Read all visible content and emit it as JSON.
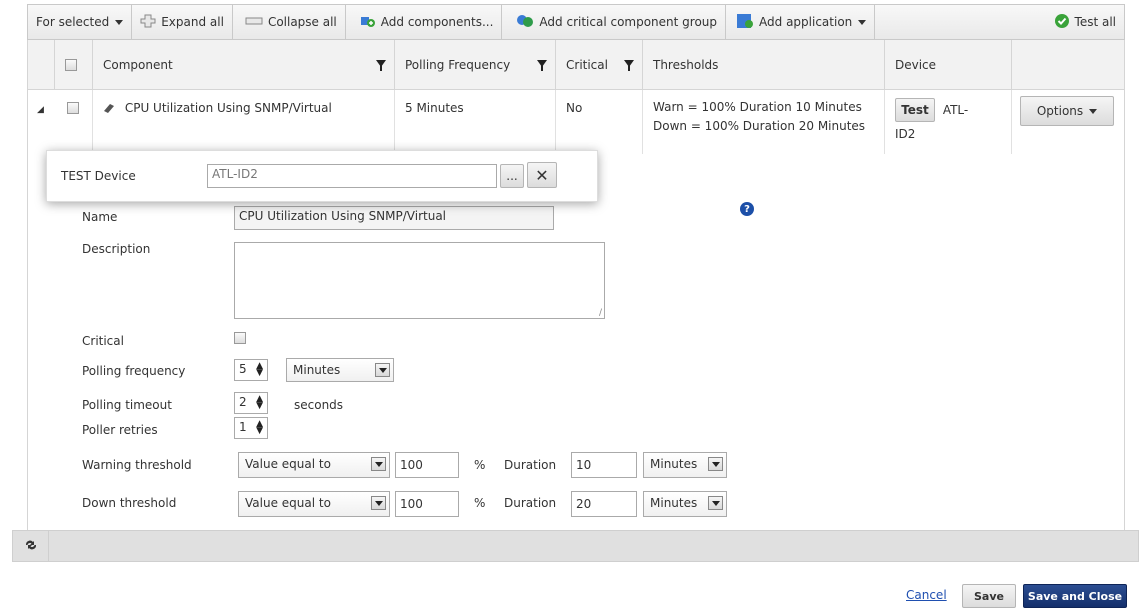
{
  "toolbar": {
    "for_selected": "For selected",
    "expand_all": "Expand all",
    "collapse_all": "Collapse all",
    "add_components": "Add components...",
    "add_critical_group": "Add critical component group",
    "add_application": "Add application",
    "test_all": "Test all"
  },
  "columns": {
    "component": "Component",
    "polling_frequency": "Polling Frequency",
    "critical": "Critical",
    "thresholds": "Thresholds",
    "device": "Device"
  },
  "row": {
    "component": "CPU Utilization Using SNMP/Virtual",
    "polling_frequency": "5 Minutes",
    "critical": "No",
    "threshold_warn": "Warn = 100% Duration 10 Minutes",
    "threshold_down": "Down = 100% Duration 20 Minutes",
    "test_label": "Test",
    "device_line1": "ATL-",
    "device_line2": "ID2",
    "options_label": "Options"
  },
  "popup": {
    "label": "TEST Device",
    "value": "ATL-ID2",
    "browse_label": "...",
    "clear_label": "✕"
  },
  "form": {
    "name_label": "Name",
    "name_value": "CPU Utilization Using SNMP/Virtual",
    "description_label": "Description",
    "description_value": "",
    "critical_label": "Critical",
    "polling_frequency_label": "Polling frequency",
    "polling_frequency_value": "5",
    "polling_frequency_unit": "Minutes",
    "polling_timeout_label": "Polling timeout",
    "polling_timeout_value": "2",
    "polling_timeout_unit": "seconds",
    "poller_retries_label": "Poller retries",
    "poller_retries_value": "1",
    "warning_label": "Warning threshold",
    "warning_operator": "Value equal to",
    "warning_value": "100",
    "warning_percent": "%",
    "warning_duration_label": "Duration",
    "warning_duration_value": "10",
    "warning_duration_unit": "Minutes",
    "down_label": "Down threshold",
    "down_operator": "Value equal to",
    "down_value": "100",
    "down_percent": "%",
    "down_duration_label": "Duration",
    "down_duration_value": "20",
    "down_duration_unit": "Minutes",
    "help_icon": "?"
  },
  "footer": {
    "cancel": "Cancel",
    "save": "Save",
    "save_close": "Save and Close"
  },
  "colors": {
    "primary_button": "#132f6b",
    "link": "#1f4fb0",
    "help_icon": "#1c4fa8",
    "test_all_icon": "#3aa33a"
  }
}
